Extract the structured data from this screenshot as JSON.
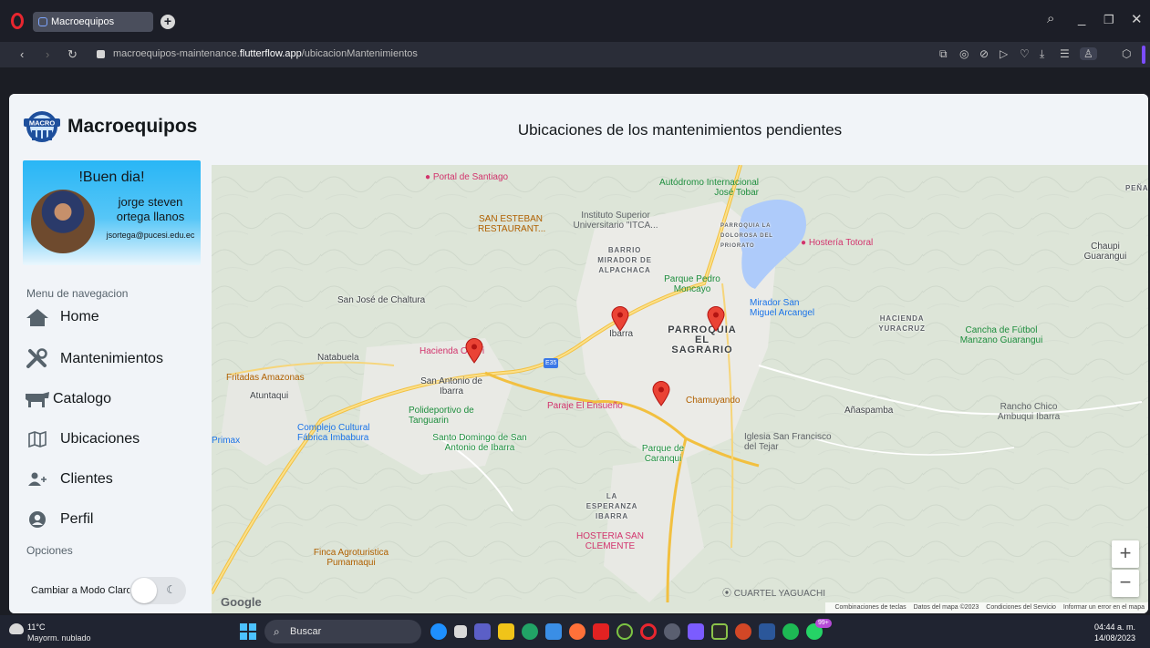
{
  "browser": {
    "tab_title": "Macroequipos",
    "new_tab_icon": "plus-icon",
    "url_prefix": "macroequipos-maintenance.",
    "url_domain": "flutterflow.app",
    "url_path": "/ubicacionMantenimientos"
  },
  "app": {
    "brand_name": "Macroequipos",
    "logo_text": "MACRO",
    "greeting": "!Buen dia!",
    "user_name": "jorge steven ortega llanos",
    "user_email": "jsortega@pucesi.edu.ec",
    "nav_section_label": "Menu de navegacion",
    "nav": [
      {
        "label": "Home",
        "icon": "home-icon"
      },
      {
        "label": "Mantenimientos",
        "icon": "tools-icon"
      },
      {
        "label": "Catalogo",
        "icon": "cow-icon"
      },
      {
        "label": "Ubicaciones",
        "icon": "map-icon"
      },
      {
        "label": "Clientes",
        "icon": "group-add-icon"
      },
      {
        "label": "Perfil",
        "icon": "account-circle-icon"
      }
    ],
    "options_label": "Opciones",
    "mode_toggle_label": "Cambiar a Modo Claro",
    "page_title": "Ubicaciones de los mantenimientos pendientes"
  },
  "map": {
    "places": [
      "San José de Chaltura",
      "Natabuela",
      "Atuntaqui",
      "San Antonio de Ibarra",
      "Ibarra",
      "PARROQUIA EL SAGRARIO",
      "Añaspamba",
      "Santo Domingo de San Antonio de Ibarra",
      "Parque de Caranqui",
      "LA ESPERANZA IBARRA",
      "Chaupi Guarangui",
      "HACIENDA YURACRUZ",
      "BARRIO MIRADOR DE ALPACHACA",
      "PARROQUIA LA DOLOROSA DEL PRIORATO",
      "PEÑA"
    ],
    "pois": [
      "Portal de Santiago",
      "SAN ESTEBAN RESTAURANT...",
      "Instituto Superior Universitario \"ITCA...",
      "Autódromo Internacional José Tobar",
      "Hostería Totoral",
      "Parque Pedro Moncayo",
      "Mirador San Miguel Arcangel",
      "Cancha de Fútbol Manzano Guarangui",
      "Hacienda Orlavi",
      "Fritadas Amazonas",
      "Polideportivo de Tanguarin",
      "Complejo Cultural Fábrica Imbabura",
      "Paraje El Ensueño",
      "Chamuyando",
      "Iglesia San Francisco del Tejar",
      "Rancho Chico Ambuqui Ibarra",
      "HOSTERIA SAN CLEMENTE",
      "Finca Agroturistica Pumamaqui",
      "CUARTEL YAGUACHI",
      "Primax"
    ],
    "road_label": "E35",
    "zoom_in": "+",
    "zoom_out": "−",
    "google_logo": "Google",
    "attribution": [
      "Combinaciones de teclas",
      "Datos del mapa ©2023",
      "Condiciones del Servicio",
      "Informar un error en el mapa"
    ]
  },
  "taskbar": {
    "temp": "11°C",
    "weather": "Mayorm. nublado",
    "search_placeholder": "Buscar",
    "badge": "99+",
    "time": "04:44 a. m.",
    "date": "14/08/2023"
  }
}
